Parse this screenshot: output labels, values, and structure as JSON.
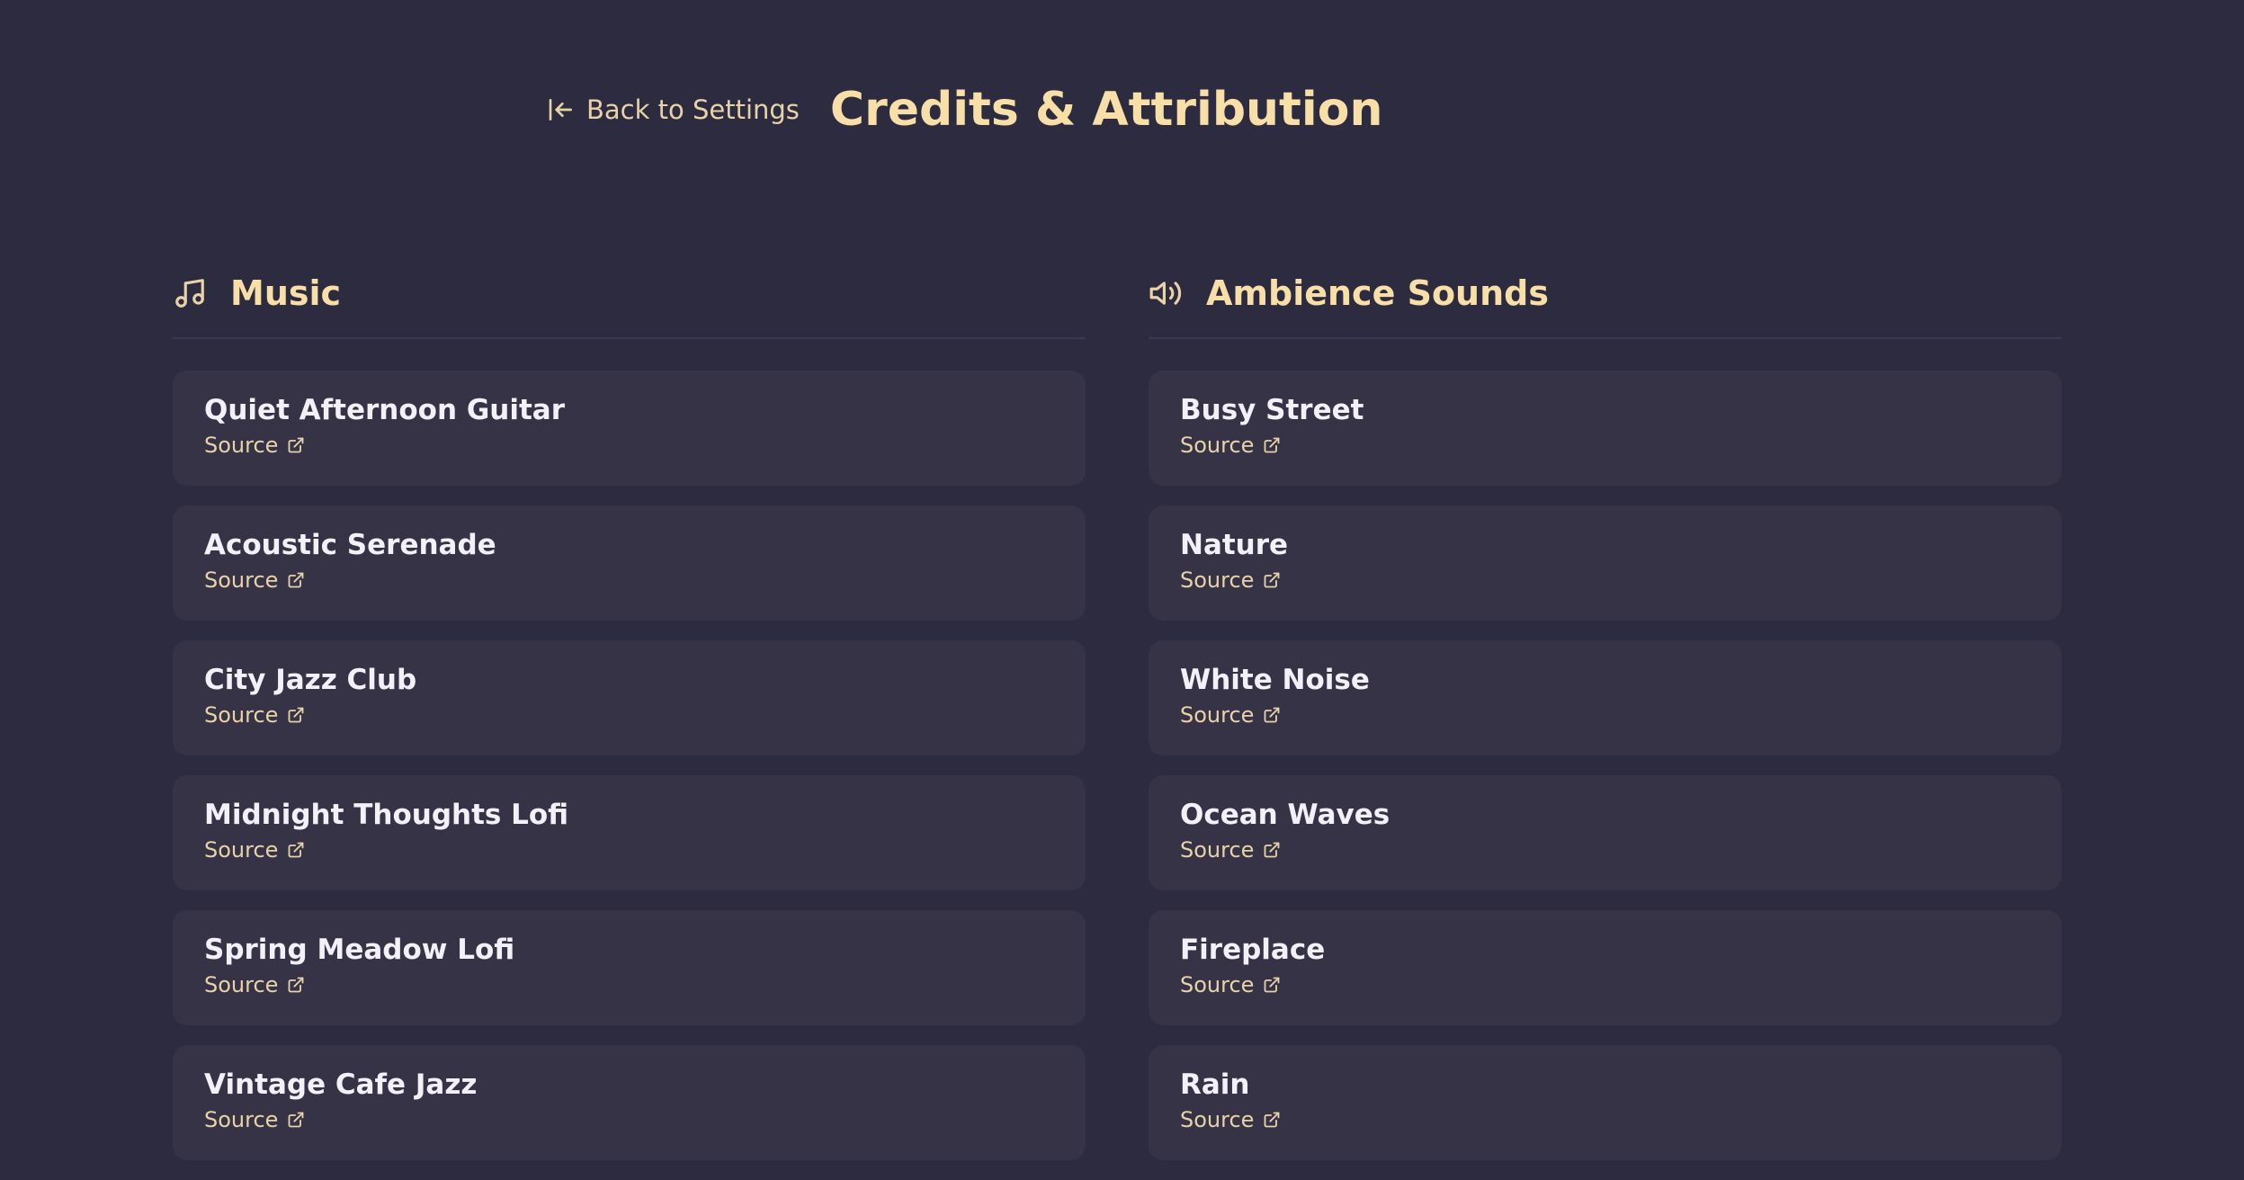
{
  "header": {
    "back_label": "Back to Settings",
    "title": "Credits & Attribution"
  },
  "colors": {
    "background": "#2d2b40",
    "card": "#363347",
    "accent": "#f8dfa7",
    "link": "#e8d2a8",
    "text": "#f3f0f7"
  },
  "music": {
    "icon": "music-note-icon",
    "title": "Music",
    "items": [
      {
        "name": "Quiet Afternoon Guitar",
        "link": "Source"
      },
      {
        "name": "Acoustic Serenade",
        "link": "Source"
      },
      {
        "name": "City Jazz Club",
        "link": "Source"
      },
      {
        "name": "Midnight Thoughts Lofi",
        "link": "Source"
      },
      {
        "name": "Spring Meadow Lofi",
        "link": "Source"
      },
      {
        "name": "Vintage Cafe Jazz",
        "link": "Source"
      }
    ]
  },
  "ambience": {
    "icon": "speaker-icon",
    "title": "Ambience Sounds",
    "items": [
      {
        "name": "Busy Street",
        "link": "Source"
      },
      {
        "name": "Nature",
        "link": "Source"
      },
      {
        "name": "White Noise",
        "link": "Source"
      },
      {
        "name": "Ocean Waves",
        "link": "Source"
      },
      {
        "name": "Fireplace",
        "link": "Source"
      },
      {
        "name": "Rain",
        "link": "Source"
      }
    ]
  }
}
